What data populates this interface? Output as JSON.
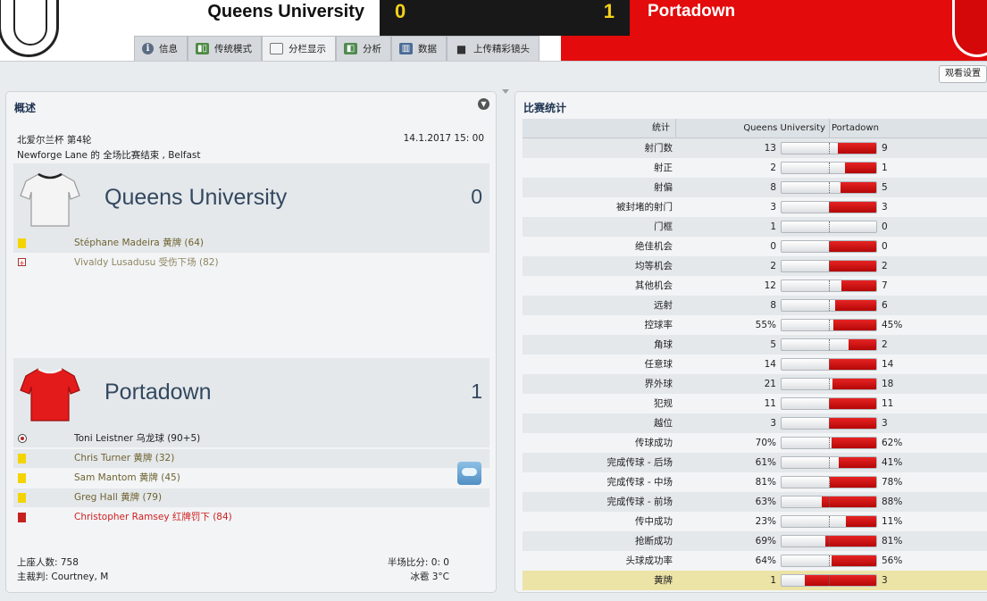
{
  "header": {
    "home_team": "Queens University",
    "away_team": "Portadown",
    "home_score": "0",
    "away_score": "1",
    "colors": {
      "away_band": "#e30b0b",
      "score_bg": "#181818",
      "score_text": "#f4d11a"
    }
  },
  "tabs": [
    {
      "label": "信息",
      "icon": "info-icon"
    },
    {
      "label": "传统模式",
      "icon": "pitch-icon"
    },
    {
      "label": "分栏显示",
      "icon": "split-view-icon",
      "active": true
    },
    {
      "label": "分析",
      "icon": "analysis-icon"
    },
    {
      "label": "数据",
      "icon": "data-chart-icon"
    },
    {
      "label": "上传精彩镜头",
      "icon": "camera-icon"
    }
  ],
  "view_settings_label": "观看设置",
  "overview": {
    "title": "概述",
    "competition": "北爱尔兰杯 第4轮",
    "venue": "Newforge Lane 的 全场比赛结束 , Belfast",
    "datetime": "14.1.2017 15: 00",
    "home": {
      "name": "Queens University",
      "score": "0",
      "events": [
        {
          "type": "yellow-card",
          "text": "Stéphane Madeira 黄牌 (64)"
        },
        {
          "type": "injury",
          "text": "Vivaldy Lusadusu 受伤下场 (82)"
        }
      ]
    },
    "away": {
      "name": "Portadown",
      "score": "1",
      "events": [
        {
          "type": "own-goal",
          "text": "Toni Leistner 乌龙球 (90+5)"
        },
        {
          "type": "yellow-card",
          "text": "Chris Turner 黄牌 (32)"
        },
        {
          "type": "yellow-card",
          "text": "Sam Mantom 黄牌 (45)"
        },
        {
          "type": "yellow-card",
          "text": "Greg Hall 黄牌 (79)"
        },
        {
          "type": "red-card",
          "text": "Christopher Ramsey 红牌罚下 (84)"
        }
      ]
    },
    "attendance": "上座人数: 758",
    "referee": "主裁判: Courtney, M",
    "halftime": "半场比分: 0: 0",
    "weather": "冰雹 3°C"
  },
  "stats": {
    "title": "比赛统计",
    "col_stat": "统计",
    "col_home": "Queens University",
    "col_away": "Portadown",
    "rows": [
      {
        "label": "射门数",
        "home": "13",
        "away": "9",
        "away_share": 0.41
      },
      {
        "label": "射正",
        "home": "2",
        "away": "1",
        "away_share": 0.33
      },
      {
        "label": "射偏",
        "home": "8",
        "away": "5",
        "away_share": 0.38
      },
      {
        "label": "被封堵的射门",
        "home": "3",
        "away": "3",
        "away_share": 0.5
      },
      {
        "label": "门框",
        "home": "1",
        "away": "0",
        "away_share": 0.0
      },
      {
        "label": "绝佳机会",
        "home": "0",
        "away": "0",
        "away_share": 0.5
      },
      {
        "label": "均等机会",
        "home": "2",
        "away": "2",
        "away_share": 0.5
      },
      {
        "label": "其他机会",
        "home": "12",
        "away": "7",
        "away_share": 0.37
      },
      {
        "label": "远射",
        "home": "8",
        "away": "6",
        "away_share": 0.43
      },
      {
        "label": "控球率",
        "home": "55%",
        "away": "45%",
        "away_share": 0.45
      },
      {
        "label": "角球",
        "home": "5",
        "away": "2",
        "away_share": 0.29
      },
      {
        "label": "任意球",
        "home": "14",
        "away": "14",
        "away_share": 0.5
      },
      {
        "label": "界外球",
        "home": "21",
        "away": "18",
        "away_share": 0.46
      },
      {
        "label": "犯规",
        "home": "11",
        "away": "11",
        "away_share": 0.5
      },
      {
        "label": "越位",
        "home": "3",
        "away": "3",
        "away_share": 0.5
      },
      {
        "label": "传球成功",
        "home": "70%",
        "away": "62%",
        "away_share": 0.47
      },
      {
        "label": "完成传球 - 后场",
        "home": "61%",
        "away": "41%",
        "away_share": 0.4
      },
      {
        "label": "完成传球 - 中场",
        "home": "81%",
        "away": "78%",
        "away_share": 0.49
      },
      {
        "label": "完成传球 - 前场",
        "home": "63%",
        "away": "88%",
        "away_share": 0.58
      },
      {
        "label": "传中成功",
        "home": "23%",
        "away": "11%",
        "away_share": 0.32
      },
      {
        "label": "抢断成功",
        "home": "69%",
        "away": "81%",
        "away_share": 0.54
      },
      {
        "label": "头球成功率",
        "home": "64%",
        "away": "56%",
        "away_share": 0.47
      },
      {
        "label": "黄牌",
        "home": "1",
        "away": "3",
        "away_share": 0.75,
        "highlight": true
      }
    ]
  }
}
